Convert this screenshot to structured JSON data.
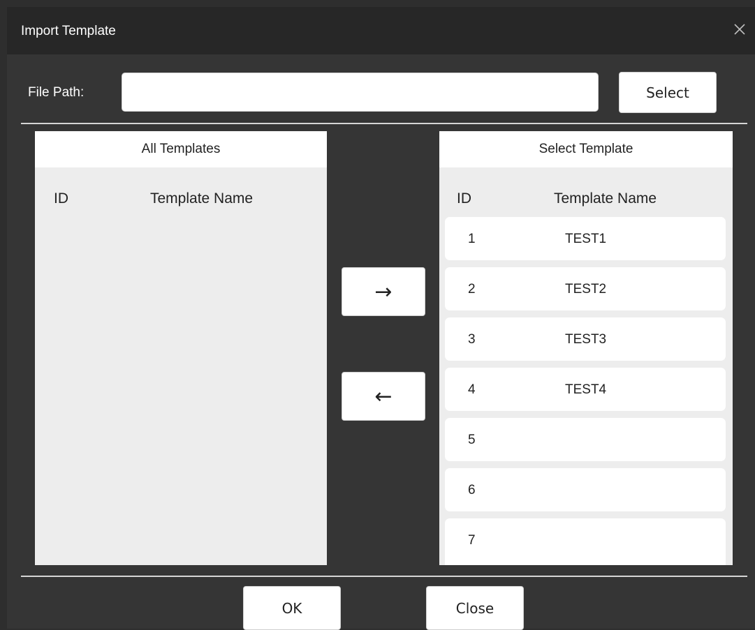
{
  "window": {
    "title": "Import Template"
  },
  "file_path": {
    "label": "File Path:",
    "value": "",
    "placeholder": "",
    "select_label": "Select"
  },
  "all_templates": {
    "header": "All Templates",
    "col_id": "ID",
    "col_name": "Template Name",
    "rows": []
  },
  "selected_templates": {
    "header": "Select Template",
    "col_id": "ID",
    "col_name": "Template Name",
    "rows": [
      {
        "id": "1",
        "name": "TEST1"
      },
      {
        "id": "2",
        "name": "TEST2"
      },
      {
        "id": "3",
        "name": "TEST3"
      },
      {
        "id": "4",
        "name": "TEST4"
      },
      {
        "id": "5",
        "name": ""
      },
      {
        "id": "6",
        "name": ""
      },
      {
        "id": "7",
        "name": ""
      }
    ]
  },
  "transfer": {
    "move_right": "→",
    "move_left": "←"
  },
  "footer": {
    "ok_label": "OK",
    "close_label": "Close"
  },
  "icons": {
    "close": "close-icon"
  }
}
